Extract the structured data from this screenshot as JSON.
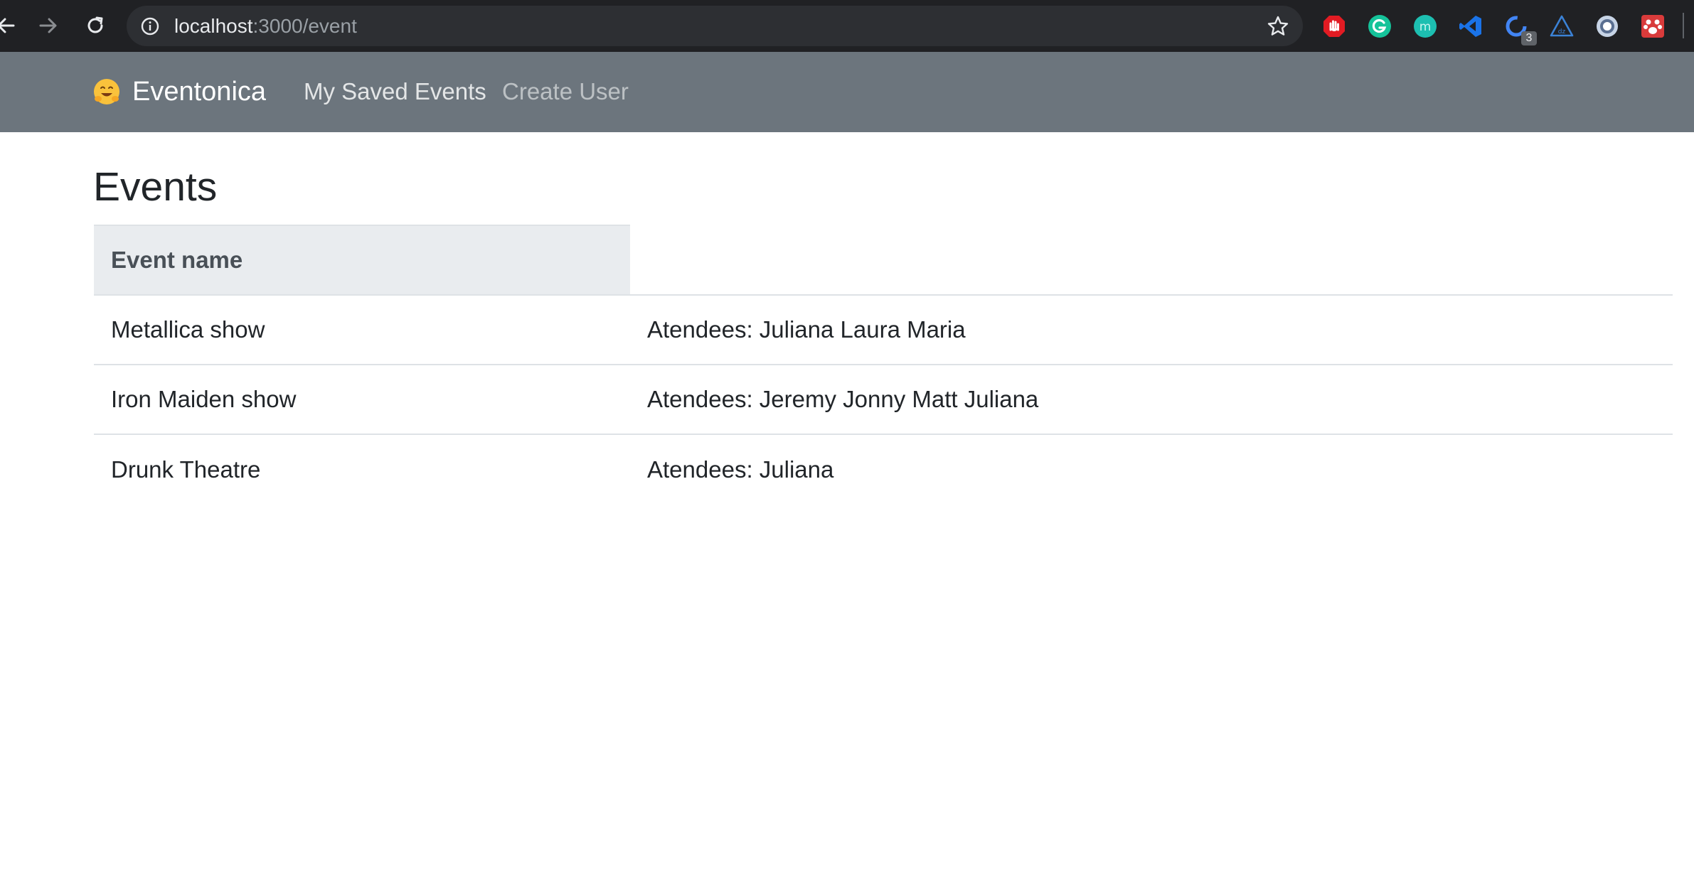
{
  "browser": {
    "url_host": "localhost",
    "url_path": ":3000/event",
    "extensions": [
      {
        "name": "adblock-icon",
        "color": "#e21b23"
      },
      {
        "name": "grammarly-icon",
        "color": "#15c39a"
      },
      {
        "name": "mercury-icon",
        "color": "#1dbfb1"
      },
      {
        "name": "vscode-icon",
        "color": "#1a73e8"
      },
      {
        "name": "loading-extension-icon",
        "color": "#4285f4",
        "badge": "3"
      },
      {
        "name": "triangle-extension-icon",
        "color": "#3b82d6"
      },
      {
        "name": "ring-extension-icon",
        "color": "#9db4d6"
      },
      {
        "name": "paw-extension-icon",
        "color": "#d93b3b"
      }
    ]
  },
  "navbar": {
    "brand_emoji": "🤗",
    "brand": "Eventonica",
    "links": [
      {
        "label": "My Saved Events"
      },
      {
        "label": "Create User"
      }
    ]
  },
  "main": {
    "title": "Events",
    "table": {
      "headers": [
        "Event name",
        ""
      ],
      "rows": [
        {
          "name": "Metallica show",
          "attendees": "Atendees: Juliana Laura Maria"
        },
        {
          "name": "Iron Maiden show",
          "attendees": "Atendees: Jeremy Jonny Matt Juliana"
        },
        {
          "name": "Drunk Theatre",
          "attendees": "Atendees: Juliana"
        }
      ]
    }
  },
  "colors": {
    "chrome_bg": "#202124",
    "navbar_bg": "#6c757d",
    "header_cell_bg": "#e9ecef",
    "text": "#212529"
  }
}
